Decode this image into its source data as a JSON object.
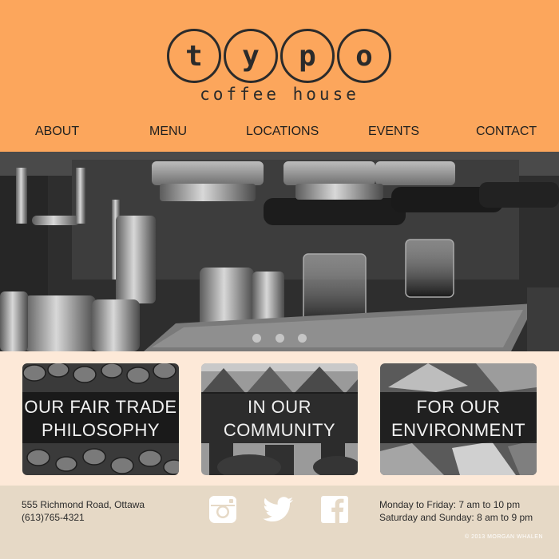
{
  "logo": {
    "letters": [
      "t",
      "y",
      "p",
      "o"
    ],
    "subtitle": "coffee house"
  },
  "nav": {
    "items": [
      "ABOUT",
      "MENU",
      "LOCATIONS",
      "EVENTS",
      "CONTACT"
    ]
  },
  "hero": {
    "image": "espresso-machine-photo",
    "slides": 3,
    "active_slide": 1
  },
  "features": [
    {
      "line1": "OUR FAIR TRADE",
      "line2": "PHILOSOPHY",
      "image": "coffee-beans-photo"
    },
    {
      "line1": "IN OUR",
      "line2": "COMMUNITY",
      "image": "row-houses-photo"
    },
    {
      "line1": "FOR OUR",
      "line2": "ENVIRONMENT",
      "image": "leaves-photo"
    }
  ],
  "footer": {
    "address_line1": "555 Richmond Road, Ottawa",
    "address_line2": "(613)765-4321",
    "hours_line1": "Monday to Friday: 7 am to 10 pm",
    "hours_line2": "Saturday and Sunday: 8 am to 9 pm",
    "social": [
      "instagram-icon",
      "twitter-icon",
      "facebook-icon"
    ],
    "copyright": "© 2013 MORGAN WHALEN"
  },
  "colors": {
    "header_bg": "#fca65c",
    "features_bg": "#fde9d8",
    "footer_bg": "#e6d9c6",
    "text_dark": "#2b2b2b"
  }
}
